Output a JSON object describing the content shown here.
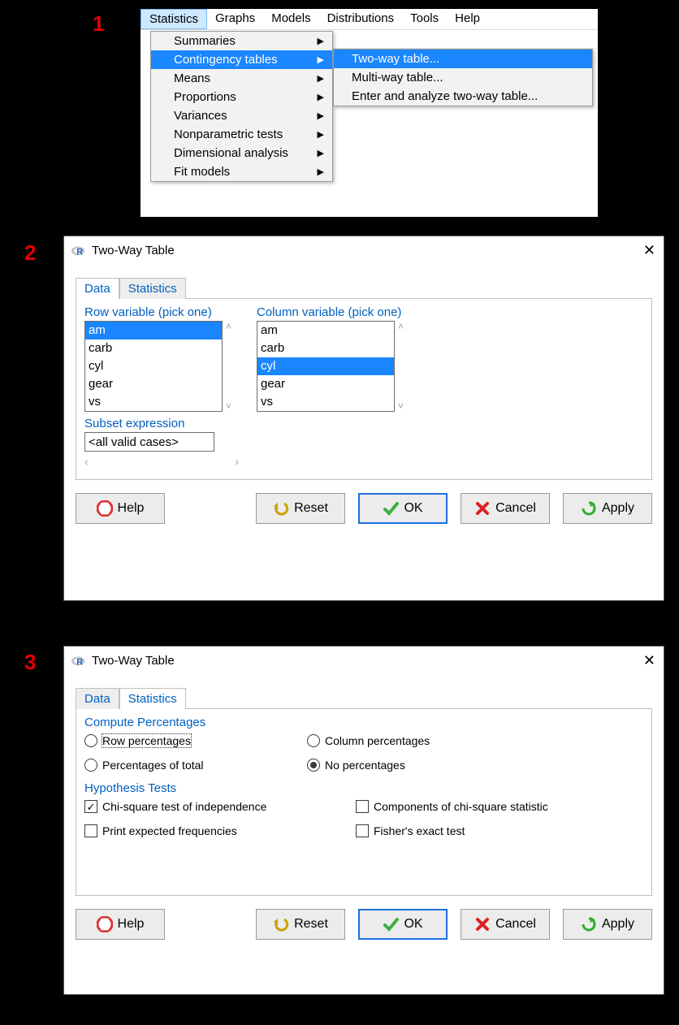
{
  "step_labels": {
    "s1": "1",
    "s2": "2",
    "s3": "3"
  },
  "panel1": {
    "menubar": [
      "Statistics",
      "Graphs",
      "Models",
      "Distributions",
      "Tools",
      "Help"
    ],
    "dropdown": [
      {
        "label": "Summaries",
        "arrow": true
      },
      {
        "label": "Contingency tables",
        "arrow": true,
        "hl": true
      },
      {
        "label": "Means",
        "arrow": true
      },
      {
        "label": "Proportions",
        "arrow": true
      },
      {
        "label": "Variances",
        "arrow": true
      },
      {
        "label": "Nonparametric tests",
        "arrow": true
      },
      {
        "label": "Dimensional analysis",
        "arrow": true
      },
      {
        "label": "Fit models",
        "arrow": true
      }
    ],
    "submenu": [
      {
        "label": "Two-way table...",
        "hl": true
      },
      {
        "label": "Multi-way table..."
      },
      {
        "label": "Enter and analyze two-way table..."
      }
    ]
  },
  "dialog_title": "Two-Way Table",
  "tabs": {
    "data": "Data",
    "stats": "Statistics"
  },
  "data_tab": {
    "row_label": "Row variable (pick one)",
    "col_label": "Column variable (pick one)",
    "vars": [
      "am",
      "carb",
      "cyl",
      "gear",
      "vs"
    ],
    "row_selected": "am",
    "col_selected": "cyl",
    "subset_label": "Subset expression",
    "subset_value": "<all valid cases>"
  },
  "stats_tab": {
    "percent_label": "Compute Percentages",
    "opts": {
      "row": "Row percentages",
      "col": "Column percentages",
      "total": "Percentages of total",
      "none": "No percentages"
    },
    "hyp_label": "Hypothesis Tests",
    "checks": {
      "chisq": "Chi-square test of independence",
      "comp": "Components of chi-square statistic",
      "expected": "Print expected frequencies",
      "fisher": "Fisher's exact test"
    }
  },
  "buttons": {
    "help": "Help",
    "reset": "Reset",
    "ok": "OK",
    "cancel": "Cancel",
    "apply": "Apply"
  }
}
